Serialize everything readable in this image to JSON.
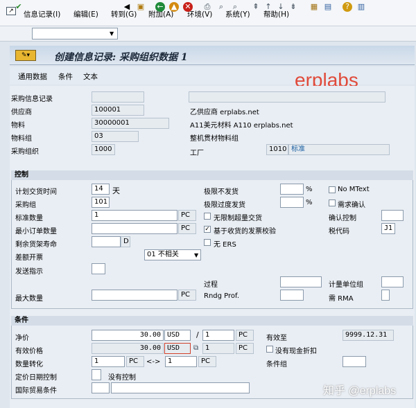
{
  "menu": {
    "items": [
      "信息记录(I)",
      "编辑(E)",
      "转到(G)",
      "附加(A)",
      "环境(V)",
      "系统(Y)",
      "帮助(H)"
    ]
  },
  "toolbar": {
    "command_field": ""
  },
  "title": "创建信息记录: 采购组织数据 1",
  "app_toolbar": [
    "通用数据",
    "条件",
    "文本"
  ],
  "watermark": "erplabs",
  "watermark2": "知乎 @erplabs",
  "header": {
    "info_record_label": "采购信息记录",
    "info_record_value": "",
    "vendor_label": "供应商",
    "vendor_value": "100001",
    "vendor_desc": "乙供应商 erplabs.net",
    "material_label": "物料",
    "material_value": "30000001",
    "material_desc": "A11美元材料 A110 erplabs.net",
    "matgroup_label": "物料组",
    "matgroup_value": "03",
    "matgroup_desc": "整机贯材物料组",
    "porg_label": "采购组织",
    "porg_value": "1000",
    "plant_label": "工厂",
    "plant_value": "1010",
    "plant_desc": "标准"
  },
  "control": {
    "section_title": "控制",
    "plan_deliv_label": "计划交货时间",
    "plan_deliv_value": "14",
    "plan_deliv_unit": "天",
    "purch_group_label": "采购组",
    "purch_group_value": "101",
    "std_qty_label": "标准数量",
    "std_qty_value": "1",
    "std_qty_unit": "PC",
    "min_qty_label": "最小订单数量",
    "min_qty_unit": "PC",
    "shelf_label": "剩余货架寿命",
    "shelf_unit": "D",
    "diff_inv_label": "差额开票",
    "diff_inv_value": "01 不相关",
    "ship_instr_label": "发送指示",
    "max_qty_label": "最大数量",
    "max_qty_unit": "PC",
    "under_tol_label": "极限不发货",
    "under_tol_unit": "%",
    "over_tol_label": "极限过度发货",
    "over_tol_unit": "%",
    "unlimited_label": "无限制超量交货",
    "gr_iv_label": "基于收货的发票校验",
    "no_ers_label": "无 ERS",
    "no_mtext_label": "No MText",
    "ack_req_label": "需求确认",
    "conf_ctrl_label": "确认控制",
    "tax_label": "税代码",
    "tax_value": "J1",
    "process_label": "过程",
    "rndg_label": "Rndg Prof.",
    "uom_group_label": "计量单位组",
    "rma_label": "需 RMA"
  },
  "conditions": {
    "section_title": "条件",
    "net_price_label": "净价",
    "net_price_value": "30.00",
    "net_price_curr": "USD",
    "per_value": "1",
    "per_unit": "PC",
    "eff_price_label": "有效价格",
    "eff_price_value": "30.00",
    "eff_price_curr": "USD",
    "eff_per_value": "1",
    "eff_per_unit": "PC",
    "valid_to_label": "有效至",
    "valid_to_value": "9999.12.31",
    "no_cash_disc_label": "没有现金折扣",
    "conv_label": "数量转化",
    "conv_left": "1",
    "conv_left_unit": "PC",
    "conv_arrow": "<->",
    "conv_right": "1",
    "conv_right_unit": "PC",
    "cond_group_label": "条件组",
    "price_date_label": "定价日期控制",
    "price_date_value": "没有控制",
    "incoterms_label": "国际贸易条件"
  }
}
